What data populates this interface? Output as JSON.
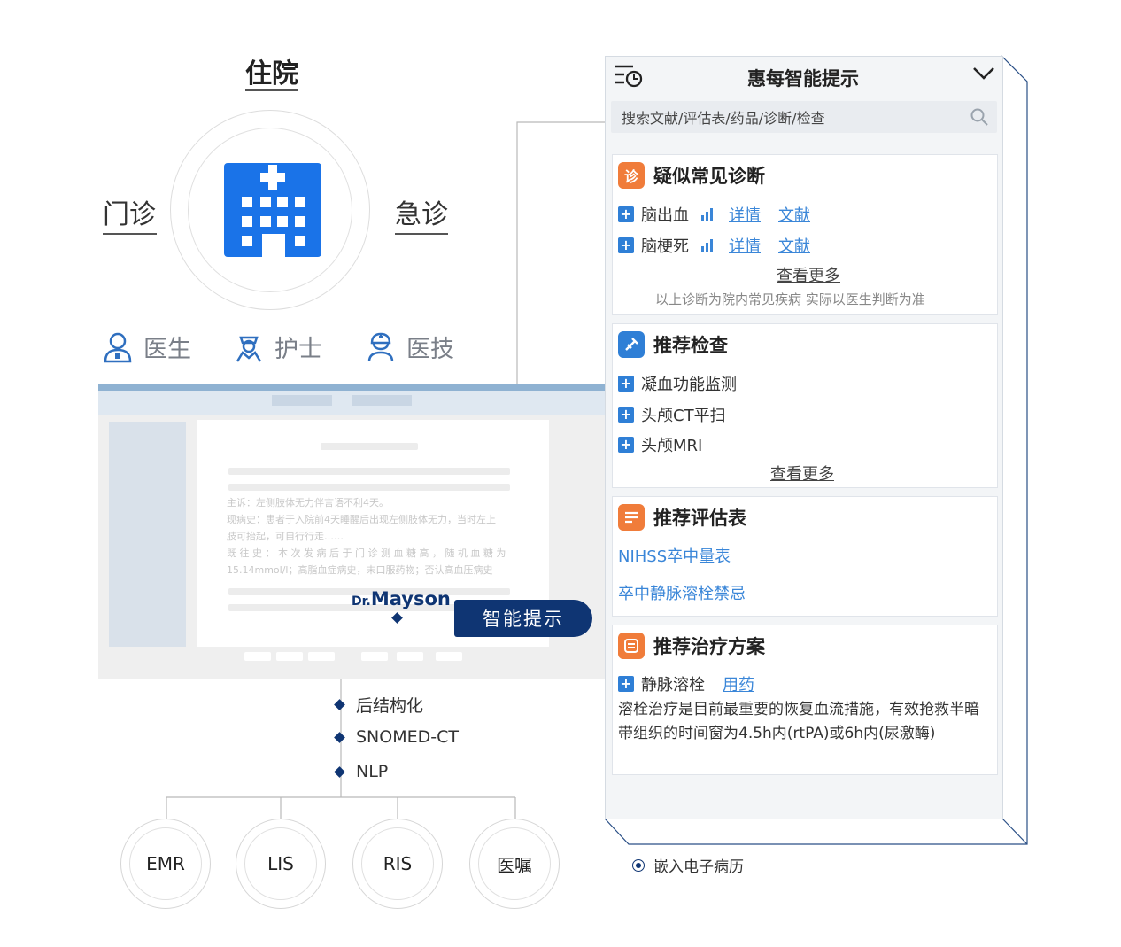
{
  "departments": {
    "top": "住院",
    "left": "门诊",
    "right": "急诊"
  },
  "roles": [
    {
      "label": "医生",
      "icon": "doctor-icon"
    },
    {
      "label": "护士",
      "icon": "nurse-icon"
    },
    {
      "label": "医技",
      "icon": "technician-icon"
    }
  ],
  "emr_mock": {
    "lines": [
      "主诉：左侧肢体无力伴言语不利4天。",
      "现病史：患者于入院前4天睡醒后出现左侧肢体无力，当时左上",
      "肢可抬起，可自行行走……",
      "既 往 史 ： 本 次 发 病 后 于 门 诊 测 血 糖 高 ， 随 机 血 糖 为",
      "15.14mmol/l；高脂血症病史，未口服药物；否认高血压病史"
    ]
  },
  "brand": {
    "prefix": "Dr.",
    "name": "Mayson"
  },
  "smart_tip_button": "智能提示",
  "tech_stack": [
    "后结构化",
    "SNOMED-CT",
    "NLP"
  ],
  "systems": [
    "EMR",
    "LIS",
    "RIS",
    "医嘱"
  ],
  "panel": {
    "title": "惠每智能提示",
    "search_placeholder": "搜索文献/评估表/药品/诊断/检查",
    "diagnosis": {
      "title": "疑似常见诊断",
      "items": [
        {
          "name": "脑出血",
          "detail": "详情",
          "literature": "文献"
        },
        {
          "name": "脑梗死",
          "detail": "详情",
          "literature": "文献"
        }
      ],
      "more": "查看更多",
      "note": "以上诊断为院内常见疾病 实际以医生判断为准"
    },
    "exams": {
      "title": "推荐检查",
      "items": [
        "凝血功能监测",
        "头颅CT平扫",
        "头颅MRI"
      ],
      "more": "查看更多"
    },
    "assessments": {
      "title": "推荐评估表",
      "items": [
        "NIHSS卒中量表",
        "卒中静脉溶栓禁忌"
      ]
    },
    "treatment": {
      "title": "推荐治疗方案",
      "item": "静脉溶栓",
      "drug_link": "用药",
      "description": "溶栓治疗是目前最重要的恢复血流措施，有效抢救半暗带组织的时间窗为4.5h内(rtPA)或6h内(尿激酶)"
    }
  },
  "embed_label": "嵌入电子病历",
  "colors": {
    "navy": "#0f3573",
    "hospital_blue": "#1a73e8",
    "accent_orange": "#f07c3a",
    "link_blue": "#3a86d8"
  }
}
